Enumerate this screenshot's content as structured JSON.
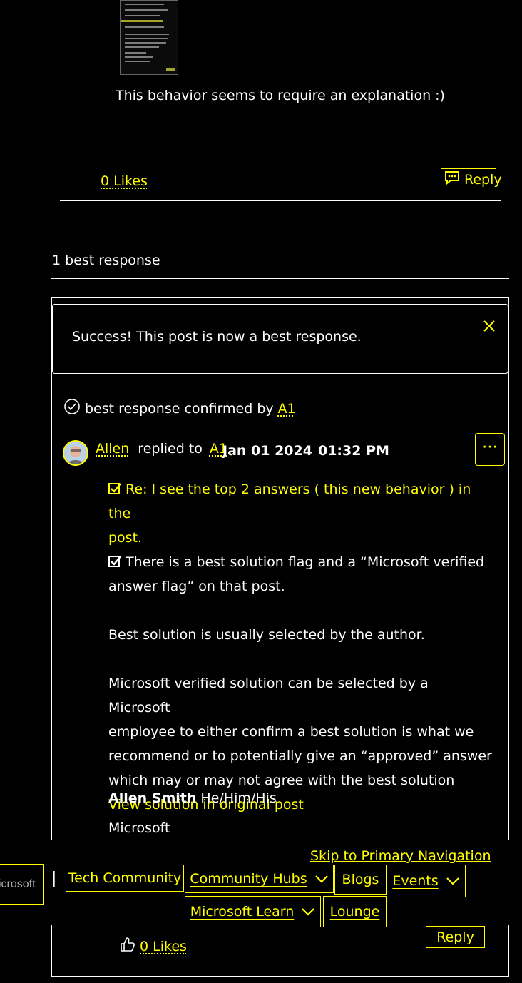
{
  "prev_post": {
    "text": "This behavior seems to require an explanation :)",
    "likes_label": "0 Likes",
    "reply_label": "Reply"
  },
  "best_response_heading": "1 best response",
  "toast": {
    "message": "Success! This post is now a best response."
  },
  "confirmed": {
    "prefix": "best response confirmed by",
    "user": "A1"
  },
  "reply": {
    "author": "Allen",
    "replied_to_label": "replied to",
    "replied_to_user": "A1",
    "date": "Jan 01 2024",
    "time": "01:32 PM",
    "quote_line1": "Re: I see the top 2 answers ( this new behavior ) in the",
    "quote_line2": "post.",
    "flag_line1": "There is a best solution flag and a “Microsoft verified",
    "flag_line2": "answer flag” on that post.",
    "para2": "Best solution is usually selected by the author.",
    "para3_l1": "Microsoft verified solution can be selected by a Microsoft",
    "para3_l2": "employee to either confirm a best solution is what we",
    "para3_l3": "recommend or to potentially give an “approved” answer",
    "para3_l4": "which may or may not agree with the best solution",
    "view_link": "View solution in original post",
    "sig_name": "Allen Smith",
    "sig_pronouns": "He/Him/His",
    "sig_company": "Microsoft",
    "likes_label": "0 Likes",
    "reply_label": "Reply"
  },
  "header": {
    "skip_link": "Skip to Primary Navigation",
    "logo_text": "icrosoft",
    "separator": "|",
    "site_title": "Tech Community",
    "nav": {
      "community_hubs": "Community Hubs",
      "blogs": "Blogs",
      "events": "Events",
      "microsoft_learn": "Microsoft Learn",
      "lounge": "Lounge"
    }
  }
}
